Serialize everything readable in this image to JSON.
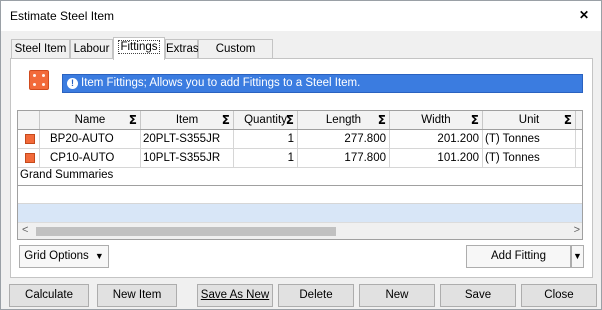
{
  "window": {
    "title": "Estimate Steel Item",
    "close_glyph": "✕"
  },
  "tabs": [
    {
      "label": "Steel Item"
    },
    {
      "label": "Labour"
    },
    {
      "label": "Fittings"
    },
    {
      "label": "Extras"
    },
    {
      "label": "Custom Fields"
    }
  ],
  "info": {
    "icon": "!",
    "text": "Item Fittings; Allows you to add Fittings to a Steel Item."
  },
  "grid": {
    "columns": [
      "Name",
      "Item",
      "Quantity",
      "Length",
      "Width",
      "Unit"
    ],
    "sigma": "Σ",
    "rows": [
      {
        "name": "BP20-AUTO",
        "item": "20PLT-S355JR",
        "quantity": "1",
        "length": "277.800",
        "width": "201.200",
        "unit": "(T) Tonnes"
      },
      {
        "name": "CP10-AUTO",
        "item": "10PLT-S355JR",
        "quantity": "1",
        "length": "177.800",
        "width": "101.200",
        "unit": "(T) Tonnes"
      }
    ],
    "summary_label": "Grand Summaries",
    "scroll_left": "<",
    "scroll_right": ">"
  },
  "panel_buttons": {
    "grid_options": "Grid Options",
    "add_fitting": "Add Fitting"
  },
  "footer": {
    "calculate": "Calculate",
    "new_item": "New Item",
    "save_as_new": "Save As New",
    "delete": "Delete",
    "new": "New",
    "save": "Save",
    "close": "Close"
  },
  "colors": {
    "accent": "#3b7ce0",
    "fitting_icon": "#f26a3a",
    "summary_band": "#d8e6f7"
  }
}
